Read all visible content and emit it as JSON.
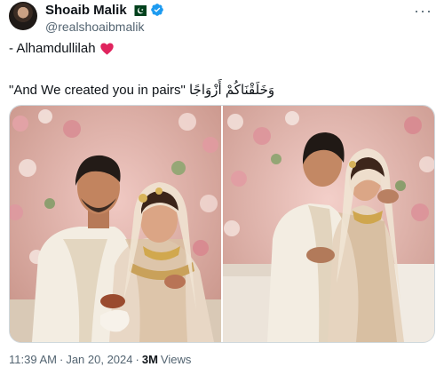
{
  "author": {
    "name": "Shoaib Malik",
    "handle": "@realshoaibmalik",
    "flag_icon": "pakistan-flag-icon",
    "verified_icon": "verified-badge-icon"
  },
  "tweet": {
    "line1": "- Alhamdullilah",
    "line2": "\"And We created you in pairs\" وَخَلَقْنَاكُمْ أَزْوَاجًا"
  },
  "footer": {
    "time": "11:39 AM",
    "date": "Jan 20, 2024",
    "separator": "·",
    "views_count": "3M",
    "views_label": "Views"
  },
  "colors": {
    "accent": "#1d9bf0",
    "heart": "#e0245e",
    "muted": "#536471"
  }
}
